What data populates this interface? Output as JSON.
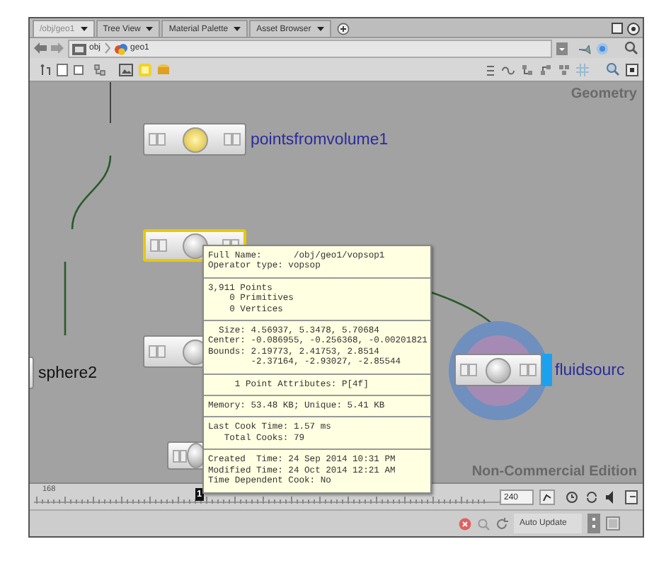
{
  "tabs": [
    {
      "label": "/obj/geo1",
      "selected": true
    },
    {
      "label": "Tree View",
      "selected": false
    },
    {
      "label": "Material Palette",
      "selected": false
    },
    {
      "label": "Asset Browser",
      "selected": false
    }
  ],
  "path": [
    "obj",
    "geo1"
  ],
  "network_type": "Geometry",
  "nodes": [
    {
      "label": "pointsfromvolume1",
      "color": "#2b2b9c",
      "selected": false,
      "display": false
    },
    {
      "selected": true,
      "display": false
    },
    {
      "selected": false,
      "display": false
    },
    {
      "label": "sphere2",
      "color": "#111111",
      "selected": false,
      "display": false
    },
    {
      "selected": false,
      "display": false
    },
    {
      "label": "fluidsourc",
      "color": "#2b2b9c",
      "selected": false,
      "display": true
    }
  ],
  "edition_label": "Non-Commercial Edition",
  "timeline": {
    "start_label": "168",
    "current_frame": "1",
    "end_frame": "240"
  },
  "status_bar": {
    "update_mode": "Auto Update"
  },
  "tooltip": {
    "sections": [
      [
        "Full Name:      /obj/geo1/vopsop1",
        "Operator type: vopsop"
      ],
      [
        "3,911 Points",
        "    0 Primitives",
        "    0 Vertices"
      ],
      [
        "  Size: 4.56937, 5.3478, 5.70684",
        "Center: -0.086955, -0.256368, -0.00201821",
        "Bounds: 2.19773, 2.41753, 2.8514",
        "        -2.37164, -2.93027, -2.85544"
      ],
      [
        "     1 Point Attributes: P[4f]"
      ],
      [
        "Memory: 53.48 KB; Unique: 5.41 KB"
      ],
      [
        "Last Cook Time: 1.57 ms",
        "   Total Cooks: 79"
      ],
      [
        "Created  Time: 24 Sep 2014 10:31 PM",
        "Modified Time: 24 Oct 2014 12:21 AM",
        "Time Dependent Cook: No"
      ]
    ]
  }
}
